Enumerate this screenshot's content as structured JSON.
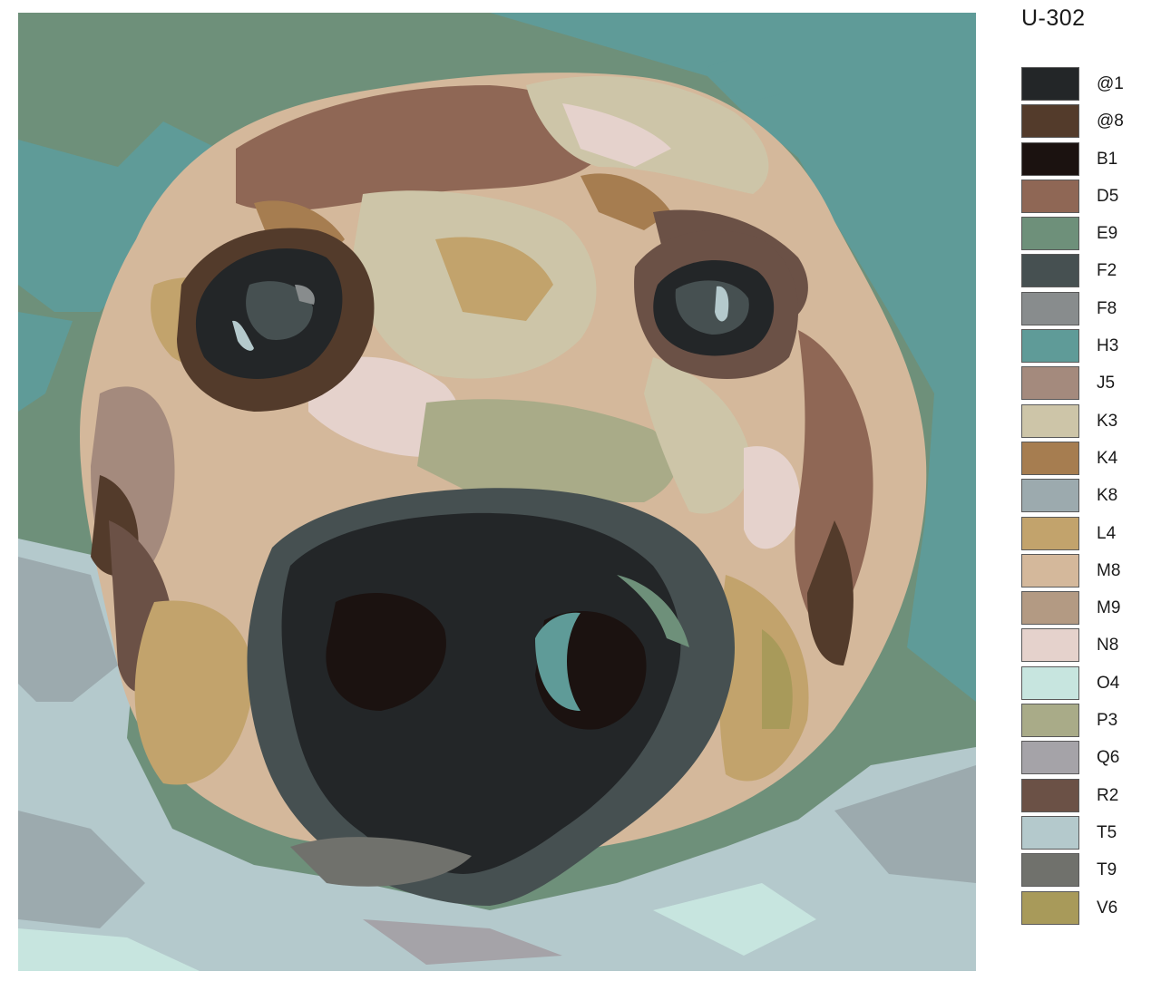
{
  "code": "U-302",
  "artwork": {
    "icon": "dog-face-painting"
  },
  "palette": [
    {
      "code": "@1",
      "color": "#232628"
    },
    {
      "code": "@8",
      "color": "#533b2b"
    },
    {
      "code": "B1",
      "color": "#1b1210"
    },
    {
      "code": "D5",
      "color": "#8f6755"
    },
    {
      "code": "E9",
      "color": "#6e907a"
    },
    {
      "code": "F2",
      "color": "#465051"
    },
    {
      "code": "F8",
      "color": "#888c8d"
    },
    {
      "code": "H3",
      "color": "#5f9b98"
    },
    {
      "code": "J5",
      "color": "#a48a7d"
    },
    {
      "code": "K3",
      "color": "#cdc5a8"
    },
    {
      "code": "K4",
      "color": "#a67d50"
    },
    {
      "code": "K8",
      "color": "#9caaae"
    },
    {
      "code": "L4",
      "color": "#c2a36c"
    },
    {
      "code": "M8",
      "color": "#d4b89b"
    },
    {
      "code": "M9",
      "color": "#b39a83"
    },
    {
      "code": "N8",
      "color": "#e5d2cc"
    },
    {
      "code": "O4",
      "color": "#c7e5df"
    },
    {
      "code": "P3",
      "color": "#a9ab88"
    },
    {
      "code": "Q6",
      "color": "#a5a3a8"
    },
    {
      "code": "R2",
      "color": "#6b5146"
    },
    {
      "code": "T5",
      "color": "#b4c9cc"
    },
    {
      "code": "T9",
      "color": "#70716c"
    },
    {
      "code": "V6",
      "color": "#a89a5a"
    }
  ]
}
